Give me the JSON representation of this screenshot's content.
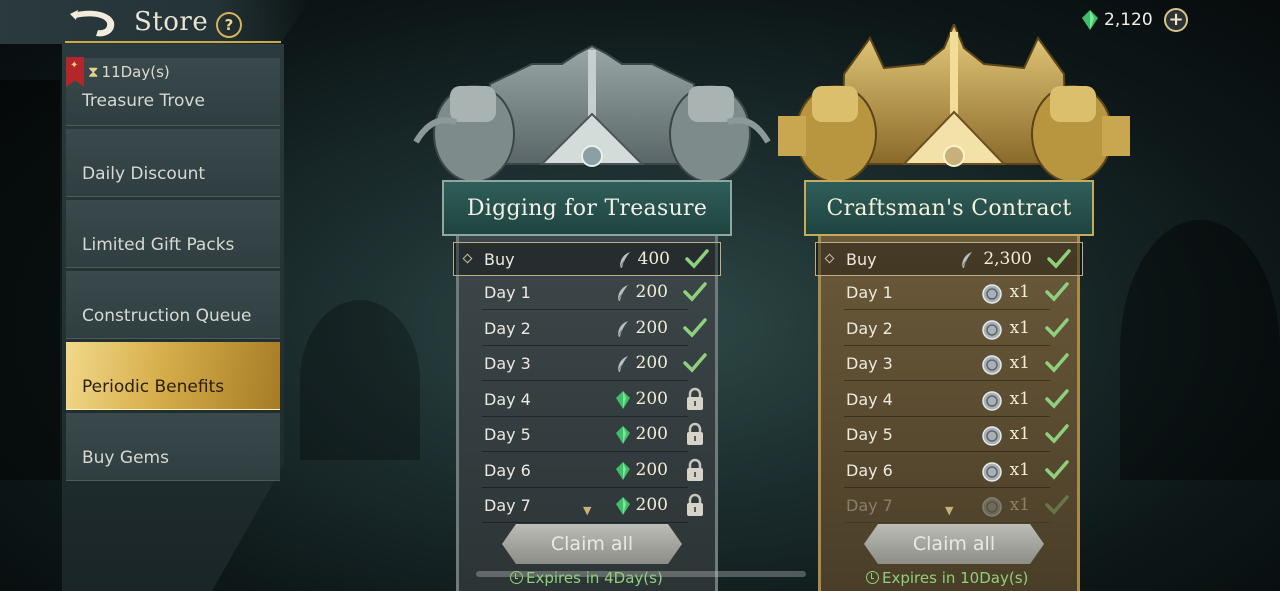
{
  "header": {
    "title": "Store",
    "help_label": "?"
  },
  "currency": {
    "amount": "2,120",
    "plus_label": "+"
  },
  "sidebar": {
    "items": [
      {
        "label": "Treasure Trove",
        "timer": "11Day(s)"
      },
      {
        "label": "Daily Discount"
      },
      {
        "label": "Limited Gift Packs"
      },
      {
        "label": "Construction Queue"
      },
      {
        "label": "Periodic Benefits"
      },
      {
        "label": "Buy Gems"
      }
    ],
    "active_index": 4
  },
  "cards": [
    {
      "title": "Digging for Treasure",
      "theme": "silver",
      "buy": {
        "label": "Buy",
        "value": "400",
        "icon": "silver-feather-icon",
        "status": "claimed"
      },
      "days": [
        {
          "label": "Day 1",
          "value": "200",
          "icon": "silver-feather-icon",
          "status": "claimed"
        },
        {
          "label": "Day 2",
          "value": "200",
          "icon": "silver-feather-icon",
          "status": "claimed"
        },
        {
          "label": "Day 3",
          "value": "200",
          "icon": "silver-feather-icon",
          "status": "claimed"
        },
        {
          "label": "Day 4",
          "value": "200",
          "icon": "green-gem-icon",
          "status": "locked"
        },
        {
          "label": "Day 5",
          "value": "200",
          "icon": "green-gem-icon",
          "status": "locked"
        },
        {
          "label": "Day 6",
          "value": "200",
          "icon": "green-gem-icon",
          "status": "locked"
        },
        {
          "label": "Day 7",
          "value": "200",
          "icon": "green-gem-icon",
          "status": "locked"
        }
      ],
      "claim_label": "Claim all",
      "expires": "Expires in 4Day(s)"
    },
    {
      "title": "Craftsman's Contract",
      "theme": "gold",
      "buy": {
        "label": "Buy",
        "value": "2,300",
        "icon": "silver-feather-icon",
        "status": "claimed"
      },
      "days": [
        {
          "label": "Day 1",
          "value": "x1",
          "icon": "silver-coin-icon",
          "status": "claimed"
        },
        {
          "label": "Day 2",
          "value": "x1",
          "icon": "silver-coin-icon",
          "status": "claimed"
        },
        {
          "label": "Day 3",
          "value": "x1",
          "icon": "silver-coin-icon",
          "status": "claimed"
        },
        {
          "label": "Day 4",
          "value": "x1",
          "icon": "silver-coin-icon",
          "status": "claimed"
        },
        {
          "label": "Day 5",
          "value": "x1",
          "icon": "silver-coin-icon",
          "status": "claimed"
        },
        {
          "label": "Day 6",
          "value": "x1",
          "icon": "silver-coin-icon",
          "status": "claimed"
        },
        {
          "label": "Day 7",
          "value": "x1",
          "icon": "silver-coin-icon",
          "status": "claimed"
        }
      ],
      "claim_label": "Claim all",
      "expires": "Expires in 10Day(s)"
    }
  ],
  "colors": {
    "accent_gold": "#d6ad4a",
    "check_green": "#8ed07b",
    "gem_green": "#3fbf6a"
  }
}
